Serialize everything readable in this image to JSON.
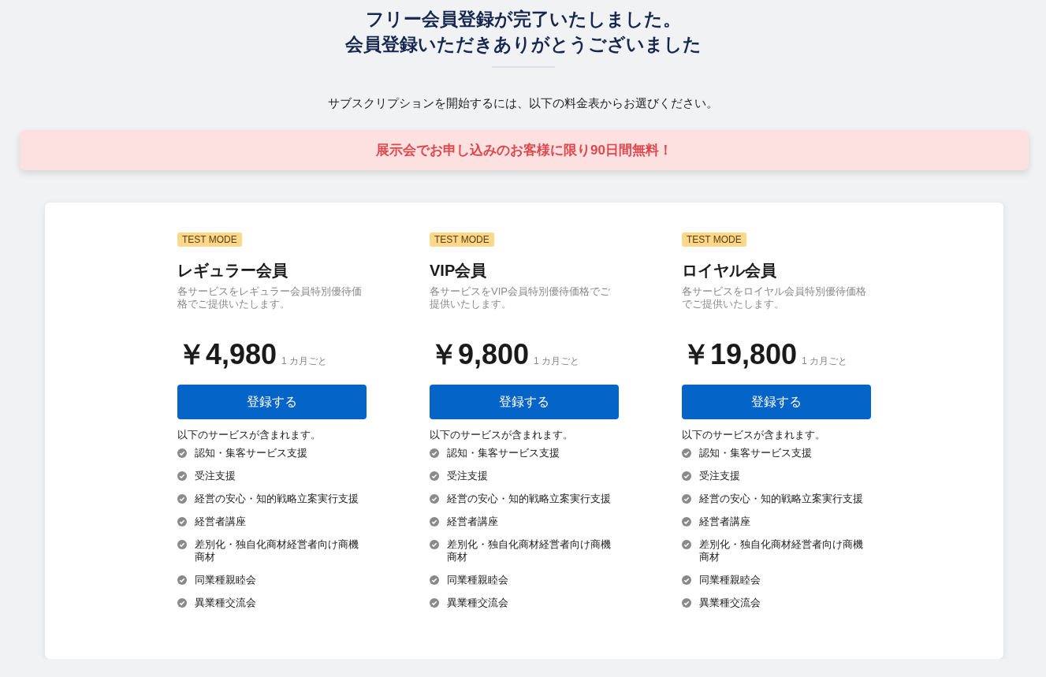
{
  "header": {
    "title_lines": [
      "フリー会員登録が完了いたしました。",
      "会員登録いただきありがとうございました"
    ],
    "subtitle": "サブスクリプションを開始するには、以下の料金表からお選びください。"
  },
  "banner": {
    "text": "展示会でお申し込みのお客様に限り90日間無料！"
  },
  "plans": [
    {
      "badge": "TEST MODE",
      "name": "レギュラー会員",
      "description": "各サービスをレギュラー会員特別優待価格でご提供いたします。",
      "price": "￥4,980",
      "period": "1 カ月ごと",
      "button": "登録する",
      "includes_label": "以下のサービスが含まれます。",
      "features": [
        "認知・集客サービス支援",
        "受注支援",
        "経営の安心・知的戦略立案実行支援",
        "経営者講座",
        "差別化・独自化商材経営者向け商機商材",
        "同業種親睦会",
        "異業種交流会"
      ]
    },
    {
      "badge": "TEST MODE",
      "name": "VIP会員",
      "description": "各サービスをVIP会員特別優待価格でご提供いたします。",
      "price": "￥9,800",
      "period": "1 カ月ごと",
      "button": "登録する",
      "includes_label": "以下のサービスが含まれます。",
      "features": [
        "認知・集客サービス支援",
        "受注支援",
        "経営の安心・知的戦略立案実行支援",
        "経営者講座",
        "差別化・独自化商材経営者向け商機商材",
        "同業種親睦会",
        "異業種交流会"
      ]
    },
    {
      "badge": "TEST MODE",
      "name": "ロイヤル会員",
      "description": "各サービスをロイヤル会員特別優待価格でご提供いたします。",
      "price": "￥19,800",
      "period": "1 カ月ごと",
      "button": "登録する",
      "includes_label": "以下のサービスが含まれます。",
      "features": [
        "認知・集客サービス支援",
        "受注支援",
        "経営の安心・知的戦略立案実行支援",
        "経営者講座",
        "差別化・独自化商材経営者向け商機商材",
        "同業種親睦会",
        "異業種交流会"
      ]
    }
  ]
}
